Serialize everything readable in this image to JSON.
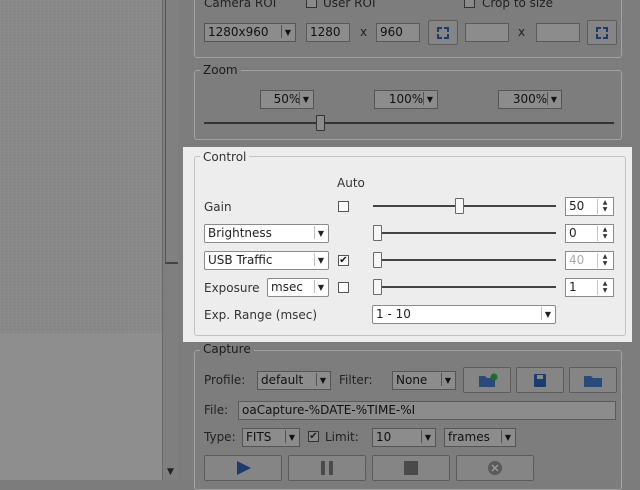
{
  "camera_roi": {
    "label": "Camera ROI",
    "user_roi_label": "User ROI",
    "crop_label": "Crop to size",
    "resolution": "1280x960",
    "width": "1280",
    "times": "x",
    "height": "960",
    "times2": "x"
  },
  "zoom": {
    "title": "Zoom",
    "options": [
      "50%",
      "100%",
      "300%"
    ]
  },
  "control": {
    "title": "Control",
    "auto_header": "Auto",
    "rows": [
      {
        "label": "Gain",
        "auto_checked": false,
        "level": 0.47,
        "value": "50"
      },
      {
        "label": "Brightness",
        "auto_checked": null,
        "level": 0.0,
        "value": "0"
      },
      {
        "label": "USB Traffic",
        "auto_checked": true,
        "level": 0.0,
        "value": "40"
      },
      {
        "label": "Exposure",
        "unit": "msec",
        "auto_checked": false,
        "level": 0.0,
        "value": "1"
      }
    ],
    "exp_range_label": "Exp. Range (msec)",
    "exp_range_value": "1 - 10"
  },
  "capture": {
    "title": "Capture",
    "profile_label": "Profile:",
    "profile_value": "default",
    "filter_label": "Filter:",
    "filter_value": "None",
    "file_label": "File:",
    "file_value": "oaCapture-%DATE-%TIME-%I",
    "type_label": "Type:",
    "type_value": "FITS",
    "limit_label": "Limit:",
    "limit_value": "10",
    "limit_unit": "frames"
  }
}
